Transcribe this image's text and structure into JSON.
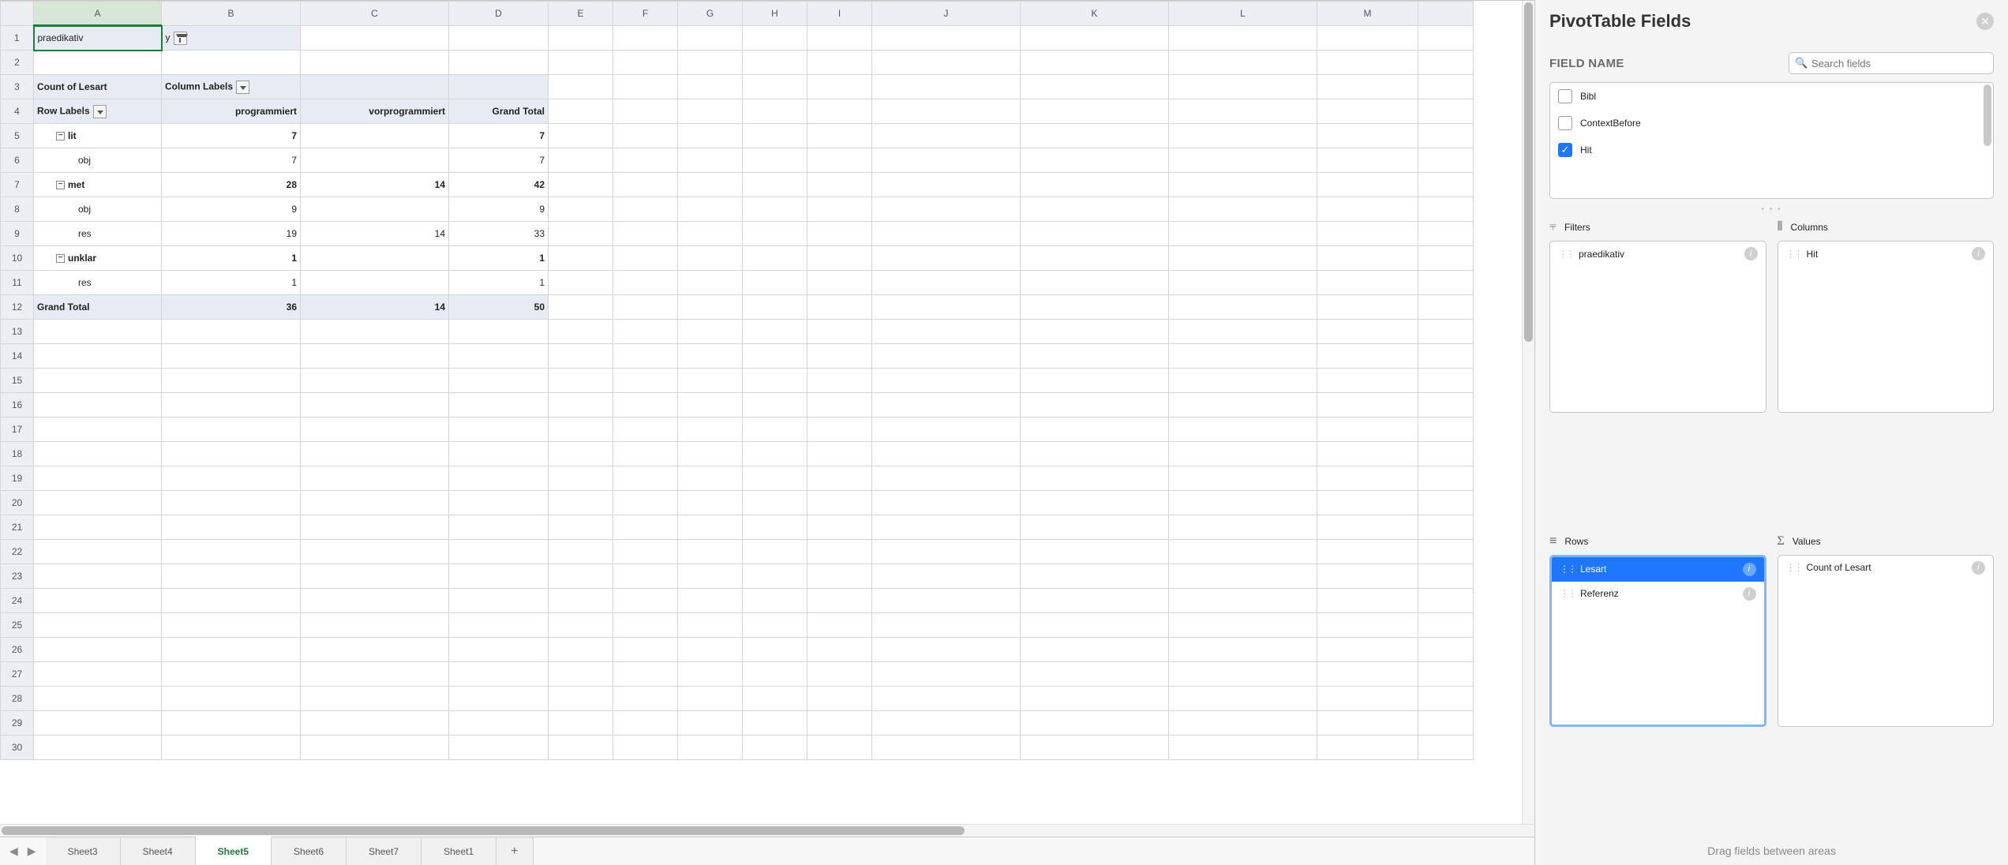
{
  "columns": [
    "A",
    "B",
    "C",
    "D",
    "E",
    "F",
    "G",
    "H",
    "I",
    "J",
    "K",
    "L",
    "M"
  ],
  "sheet": {
    "r1": {
      "a": "praedikativ",
      "b": "y"
    },
    "r3": {
      "a": "Count of Lesart",
      "b": "Column Labels"
    },
    "r4": {
      "a": "Row Labels",
      "b": "programmiert",
      "c": "vorprogrammiert",
      "d": "Grand Total"
    },
    "r5": {
      "a": "lit",
      "b": "7",
      "d": "7"
    },
    "r6": {
      "a": "obj",
      "b": "7",
      "d": "7"
    },
    "r7": {
      "a": "met",
      "b": "28",
      "c": "14",
      "d": "42"
    },
    "r8": {
      "a": "obj",
      "b": "9",
      "d": "9"
    },
    "r9": {
      "a": "res",
      "b": "19",
      "c": "14",
      "d": "33"
    },
    "r10": {
      "a": "unklar",
      "b": "1",
      "d": "1"
    },
    "r11": {
      "a": "res",
      "b": "1",
      "d": "1"
    },
    "r12": {
      "a": "Grand Total",
      "b": "36",
      "c": "14",
      "d": "50"
    }
  },
  "tabs": [
    "Sheet3",
    "Sheet4",
    "Sheet5",
    "Sheet6",
    "Sheet7",
    "Sheet1"
  ],
  "activeTab": "Sheet5",
  "panel": {
    "title": "PivotTable Fields",
    "fieldNameLabel": "FIELD NAME",
    "searchPlaceholder": "Search fields",
    "fields": [
      {
        "name": "Bibl",
        "checked": false
      },
      {
        "name": "ContextBefore",
        "checked": false
      },
      {
        "name": "Hit",
        "checked": true
      }
    ],
    "sections": {
      "filters": {
        "label": "Filters",
        "items": [
          "praedikativ"
        ]
      },
      "columns": {
        "label": "Columns",
        "items": [
          "Hit"
        ]
      },
      "rows": {
        "label": "Rows",
        "items": [
          "Lesart",
          "Referenz"
        ],
        "selected": "Lesart"
      },
      "values": {
        "label": "Values",
        "items": [
          "Count of Lesart"
        ]
      }
    },
    "footer": "Drag fields between areas"
  }
}
